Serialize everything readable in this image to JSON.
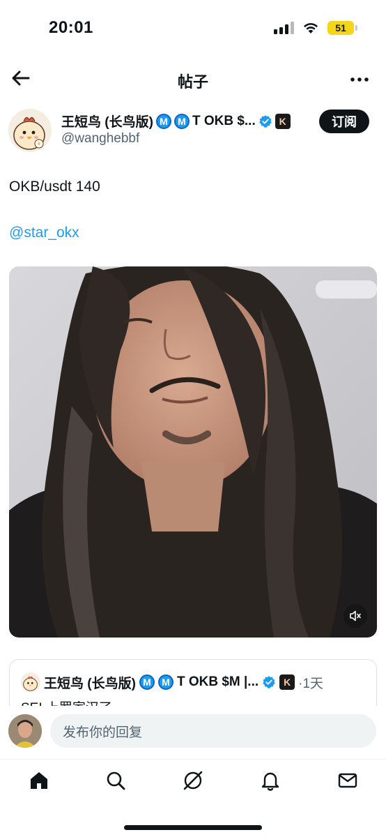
{
  "status_bar": {
    "time": "20:01",
    "battery": "51"
  },
  "header": {
    "title": "帖子"
  },
  "author": {
    "name": "王短鸟 (长鸟版)",
    "badge_m": "M",
    "name_suffix": "T OKB $...",
    "k_badge": "K",
    "handle": "@wanghebbf",
    "subscribe_label": "订阅"
  },
  "post": {
    "text": "OKB/usdt 140",
    "mention": "@star_okx"
  },
  "quote": {
    "name": "王短鸟 (长鸟版)",
    "badge_m": "M",
    "name_suffix": "T OKB $M |...",
    "k_badge": "K",
    "time": "·1天",
    "text": "SEI 上罗家汉了"
  },
  "reply": {
    "placeholder": "发布你的回复"
  },
  "colors": {
    "accent": "#1d9bf0",
    "text": "#0f1419",
    "muted": "#536471"
  }
}
